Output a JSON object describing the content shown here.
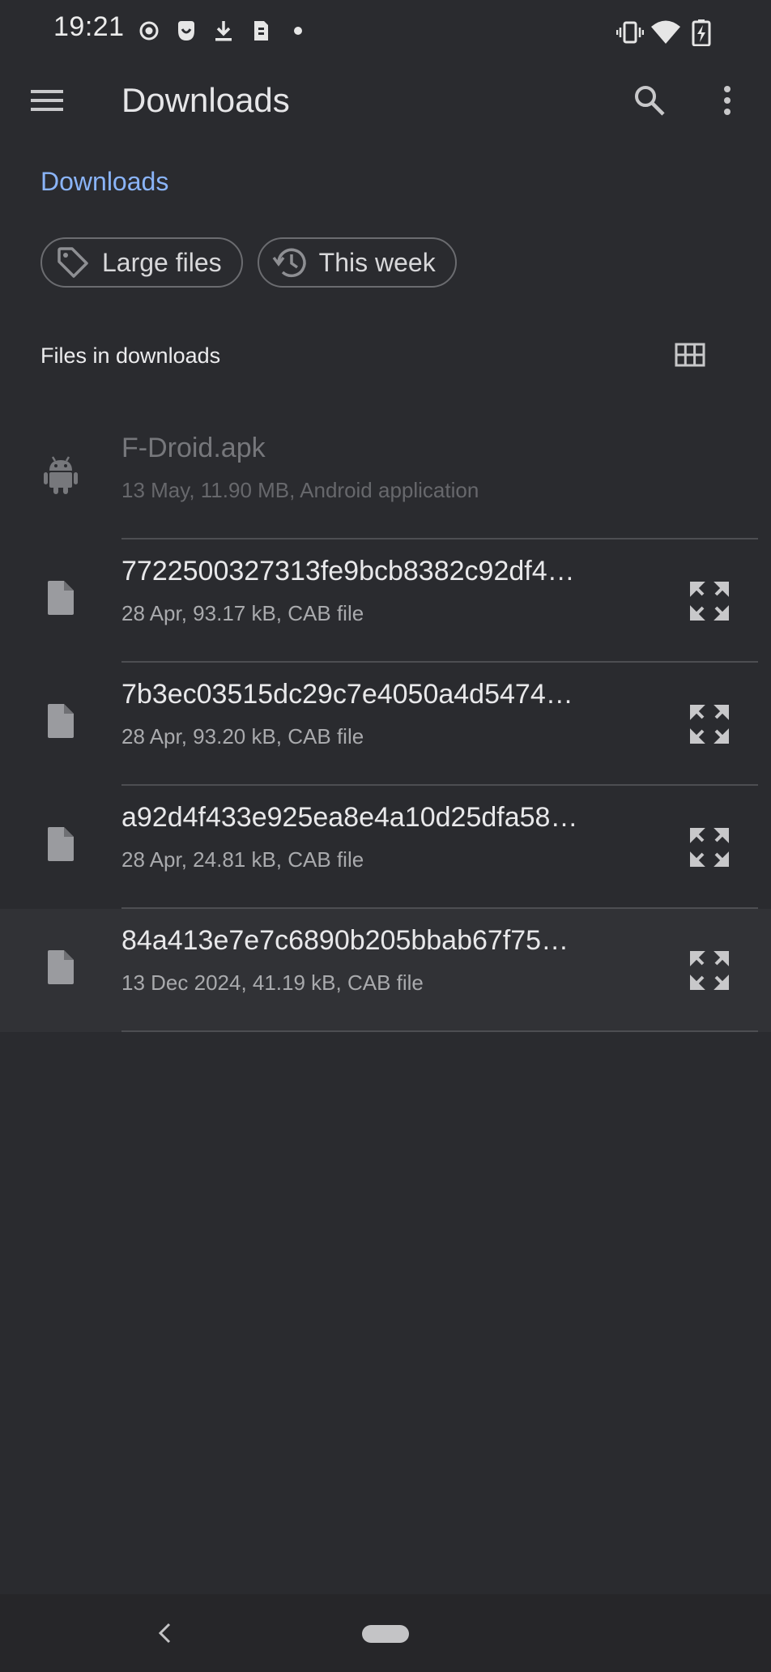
{
  "status_bar": {
    "time": "19:21",
    "left_icons": [
      "record-icon",
      "app-badge-icon",
      "download-icon",
      "sim-icon",
      "dot-icon"
    ],
    "right_icons": [
      "vibrate-icon",
      "wifi-icon",
      "battery-charging-icon"
    ]
  },
  "app_bar": {
    "title": "Downloads",
    "menu_icon": "hamburger-menu-icon",
    "search_icon": "search-icon",
    "more_icon": "more-vert-icon"
  },
  "breadcrumb": "Downloads",
  "chips": [
    {
      "label": "Large files",
      "icon": "tag-icon"
    },
    {
      "label": "This week",
      "icon": "history-icon"
    }
  ],
  "section": {
    "title": "Files in downloads",
    "view_toggle_icon": "grid-view-icon"
  },
  "files": [
    {
      "name": "F-Droid.apk",
      "meta": "13 May, 11.90 MB, Android application",
      "icon": "android-icon",
      "disabled": true
    },
    {
      "name": "7722500327313fe9bcb8382c92df4…",
      "meta": "28 Apr, 93.17 kB, CAB file",
      "icon": "file-icon"
    },
    {
      "name": "7b3ec03515dc29c7e4050a4d5474…",
      "meta": "28 Apr, 93.20 kB, CAB file",
      "icon": "file-icon"
    },
    {
      "name": "a92d4f433e925ea8e4a10d25dfa58…",
      "meta": "28 Apr, 24.81 kB, CAB file",
      "icon": "file-icon"
    },
    {
      "name": "84a413e7e7c6890b205bbab67f75…",
      "meta": "13 Dec 2024, 41.19 kB, CAB file",
      "icon": "file-icon",
      "highlighted": true
    }
  ],
  "colors": {
    "background": "#2a2b2f",
    "accent": "#8ab4f8",
    "text_primary": "#e8e8ea",
    "text_secondary": "#a9aaad"
  }
}
